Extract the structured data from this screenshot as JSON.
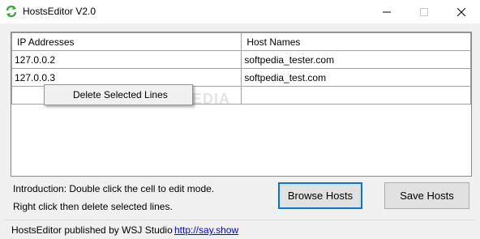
{
  "window": {
    "title": "HostsEditor V2.0",
    "controls": {
      "minimize": "—",
      "maximize": "☐",
      "close": "✕"
    }
  },
  "grid": {
    "columns": [
      "IP Addresses",
      "Host Names"
    ],
    "rows": [
      {
        "ip": "127.0.0.2",
        "host": "softpedia_tester.com"
      },
      {
        "ip": "127.0.0.3",
        "host": "softpedia_test.com"
      },
      {
        "ip": "",
        "host": ""
      }
    ]
  },
  "context_menu": {
    "item": "Delete Selected Lines"
  },
  "watermark": "SOFTPEDIA",
  "intro": {
    "line1": "Introduction: Double click the cell to edit mode.",
    "line2": "Right click then delete selected lines."
  },
  "buttons": {
    "browse": "Browse Hosts",
    "save": "Save Hosts"
  },
  "status": {
    "text": "HostsEditor published by WSJ Studio",
    "link": "http://say.show"
  },
  "colors": {
    "accent": "#0078d7",
    "icon_green": "#3aa83a"
  },
  "icons": {
    "app": "refresh-arrows-icon"
  }
}
